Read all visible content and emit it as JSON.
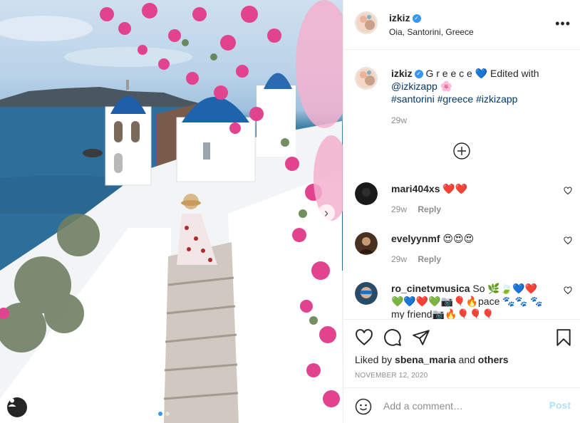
{
  "photo": {
    "alt": "Oia Santorini photo",
    "carousel": {
      "total": 2,
      "active_index": 0
    }
  },
  "header": {
    "username": "izkiz",
    "verified": true,
    "location": "Oia, Santorini, Greece",
    "more_icon": "ellipsis-icon"
  },
  "caption": {
    "username": "izkiz",
    "text_before": "G r e e c e",
    "heart": "💙",
    "text_after": " Edited with",
    "mention": "@izkizapp",
    "flower": "🌸",
    "hashtags": [
      "#santorini",
      "#greece",
      "#izkizapp"
    ],
    "time": "29w"
  },
  "comments": [
    {
      "username": "mari404xs",
      "text": "❤️❤️",
      "time": "29w",
      "reply": "Reply"
    },
    {
      "username": "evelyynmf",
      "text": "😍😍😍",
      "time": "29w",
      "reply": "Reply"
    },
    {
      "username": "ro_cinetvmusica",
      "text": "So 🌿🍃💙❤️ 💚💙❤️💚📷🎈🔥pace 🐾🐾 🐾my friend📷🔥🎈🎈🎈"
    }
  ],
  "actions": {
    "liked_by_prefix": "Liked by ",
    "liked_by_user": "sbena_maria",
    "liked_by_middle": " and ",
    "liked_by_others": "others",
    "date": "NOVEMBER 12, 2020"
  },
  "add_comment": {
    "placeholder": "Add a comment…",
    "post_label": "Post"
  },
  "colors": {
    "accent": "#3897f0",
    "post_disabled": "#b2dffc",
    "link": "#00376b",
    "muted": "#8e8e8e"
  }
}
